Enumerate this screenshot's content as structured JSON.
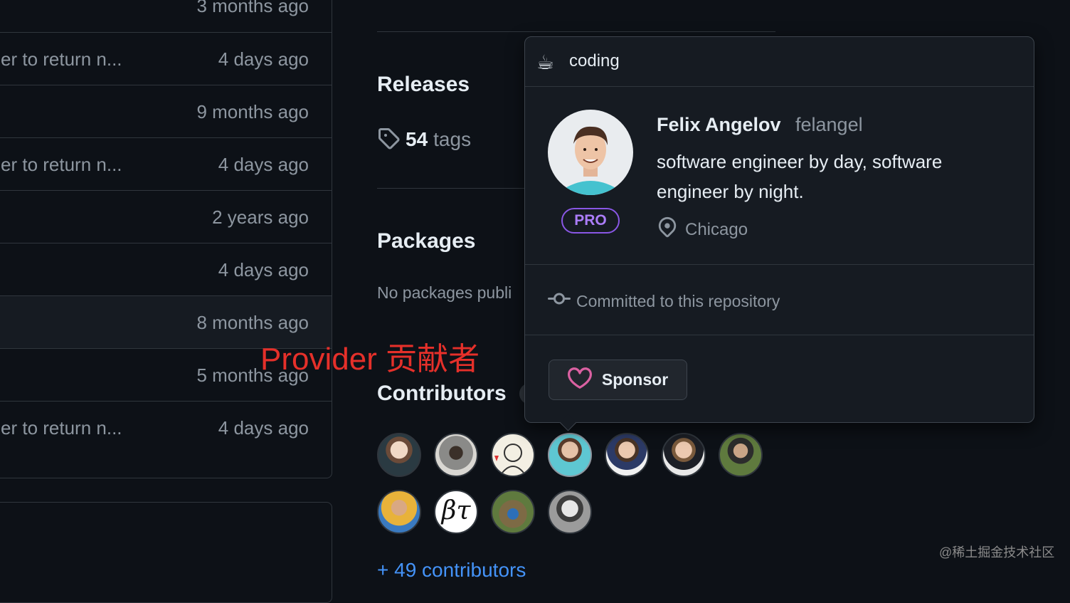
{
  "file_rows": [
    {
      "message": "",
      "time": "3 months ago"
    },
    {
      "message": "er to return n...",
      "time": "4 days ago"
    },
    {
      "message": "",
      "time": "9 months ago"
    },
    {
      "message": "er to return n...",
      "time": "4 days ago"
    },
    {
      "message": "",
      "time": "2 years ago"
    },
    {
      "message": "",
      "time": "4 days ago"
    },
    {
      "message": "",
      "time": "8 months ago"
    },
    {
      "message": "",
      "time": "5 months ago"
    },
    {
      "message": "er to return n...",
      "time": "4 days ago"
    }
  ],
  "sidebar": {
    "releases_title": "Releases",
    "tags_count": "54",
    "tags_label": "tags",
    "packages_title": "Packages",
    "packages_empty": "No packages publi",
    "contributors_title": "Contributors",
    "more_contributors": "+ 49 contributors"
  },
  "annotation": "Provider 贡献者",
  "watermark": "@稀土掘金技术社区",
  "hovercard": {
    "status_emoji": "☕",
    "status_text": "coding",
    "name": "Felix Angelov",
    "login": "felangel",
    "bio": "software engineer by day, software engineer by night.",
    "badge": "PRO",
    "location": "Chicago",
    "commit_note": "Committed to this repository",
    "sponsor_label": "Sponsor"
  },
  "colors": {
    "accent_link": "#4493f8",
    "pro_purple": "#8957e5",
    "sponsor_pink": "#db61a2",
    "annotation_red": "#e5302a"
  },
  "icons": [
    "tag-icon",
    "location-pin-icon",
    "git-commit-icon",
    "heart-icon"
  ]
}
